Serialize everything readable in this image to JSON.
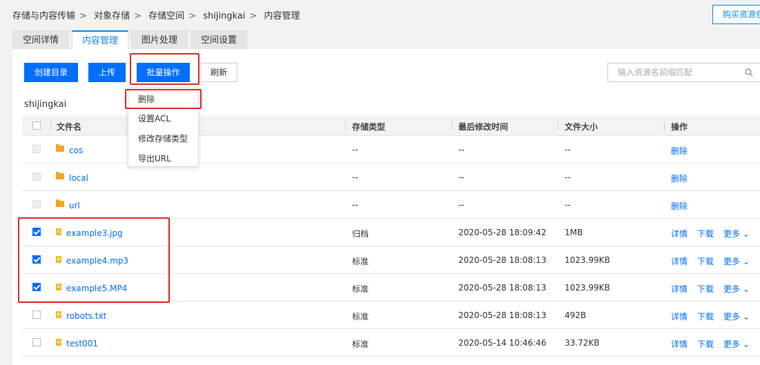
{
  "breadcrumb": [
    "存储与内容传输",
    "对象存储",
    "存储空间",
    "shijingkai",
    "内容管理"
  ],
  "buy_button": "购买资源包",
  "tabs": [
    "空间详情",
    "内容管理",
    "图片处理",
    "空间设置"
  ],
  "toolbar": {
    "create_dir": "创建目录",
    "upload": "上传",
    "batch": "批量操作",
    "refresh": "刷新"
  },
  "search": {
    "placeholder": "输入资源名前缀匹配",
    "icon": "search-icon"
  },
  "path": "shijingkai",
  "batch_menu": [
    "删除",
    "设置ACL",
    "修改存储类型",
    "导出URL"
  ],
  "table": {
    "headers": [
      "文件名",
      "存储类型",
      "最后修改时间",
      "文件大小",
      "操作"
    ],
    "rows": [
      {
        "name": "cos",
        "type": "--",
        "time": "--",
        "size": "--",
        "kind": "folder",
        "checked": false,
        "actions": [
          "删除"
        ]
      },
      {
        "name": "local",
        "type": "--",
        "time": "--",
        "size": "--",
        "kind": "folder",
        "checked": false,
        "actions": [
          "删除"
        ]
      },
      {
        "name": "url",
        "type": "--",
        "time": "--",
        "size": "--",
        "kind": "folder",
        "checked": false,
        "actions": [
          "删除"
        ]
      },
      {
        "name": "example3.jpg",
        "type": "归档",
        "time": "2020-05-28 18:09:42",
        "size": "1MB",
        "kind": "file",
        "checked": true,
        "actions": [
          "详情",
          "下载",
          "更多"
        ]
      },
      {
        "name": "example4.mp3",
        "type": "标准",
        "time": "2020-05-28 18:08:13",
        "size": "1023.99KB",
        "kind": "file",
        "checked": true,
        "actions": [
          "详情",
          "下载",
          "更多"
        ]
      },
      {
        "name": "example5.MP4",
        "type": "标准",
        "time": "2020-05-28 18:08:13",
        "size": "1023.99KB",
        "kind": "file",
        "checked": true,
        "actions": [
          "详情",
          "下载",
          "更多"
        ]
      },
      {
        "name": "robots.txt",
        "type": "标准",
        "time": "2020-05-28 18:08:13",
        "size": "492B",
        "kind": "file",
        "checked": false,
        "actions": [
          "详情",
          "下载",
          "更多"
        ]
      },
      {
        "name": "test001",
        "type": "标准",
        "time": "2020-05-14 10:46:46",
        "size": "33.72KB",
        "kind": "file",
        "checked": false,
        "actions": [
          "详情",
          "下载",
          "更多"
        ]
      }
    ]
  },
  "colors": {
    "primary": "#006eff",
    "highlight": "#e12a2a",
    "folder": "#f5a623"
  }
}
